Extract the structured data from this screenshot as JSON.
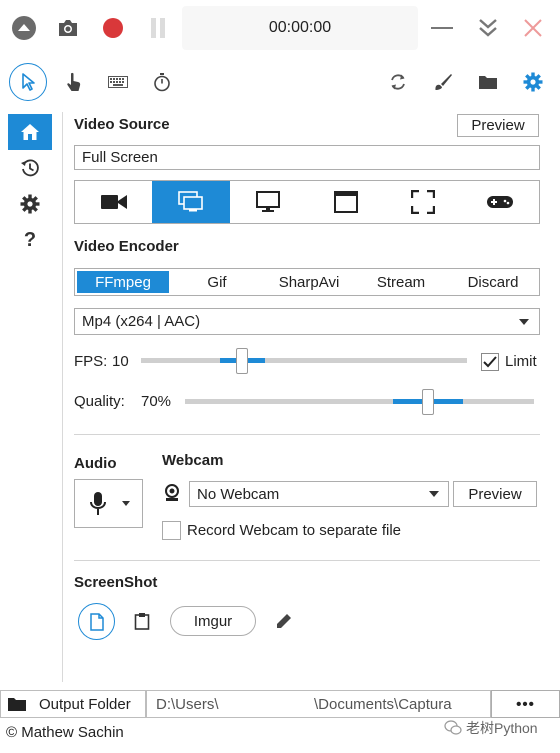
{
  "top": {
    "timer": "00:00:00"
  },
  "video_source": {
    "heading": "Video Source",
    "preview_label": "Preview",
    "value": "Full Screen",
    "modes": [
      "camera-icon",
      "screen-region-icon",
      "monitor-icon",
      "window-icon",
      "fullscreen-icon",
      "gamepad-icon"
    ],
    "active_mode": 1
  },
  "video_encoder": {
    "heading": "Video Encoder",
    "tabs": [
      "FFmpeg",
      "Gif",
      "SharpAvi",
      "Stream",
      "Discard"
    ],
    "active_tab": 0,
    "format": "Mp4 (x264 | AAC)",
    "fps_label": "FPS:",
    "fps_value": "10",
    "limit_label": "Limit",
    "limit_checked": true,
    "quality_label": "Quality:",
    "quality_value": "70%"
  },
  "audio": {
    "heading": "Audio"
  },
  "webcam": {
    "heading": "Webcam",
    "selected": "No Webcam",
    "preview_label": "Preview",
    "separate_file_label": "Record Webcam to separate file"
  },
  "screenshot": {
    "heading": "ScreenShot",
    "imgur_label": "Imgur"
  },
  "footer": {
    "output_folder_label": "Output Folder",
    "path": "D:\\Users\\                          \\Documents\\Captura",
    "path_a": "D:\\Users\\",
    "path_b": "\\Documents\\Captura",
    "more_label": "•••",
    "copyright": "© Mathew Sachin",
    "watermark": "老树Python"
  },
  "colors": {
    "accent": "#1e8ad6",
    "record": "#d9383a"
  }
}
